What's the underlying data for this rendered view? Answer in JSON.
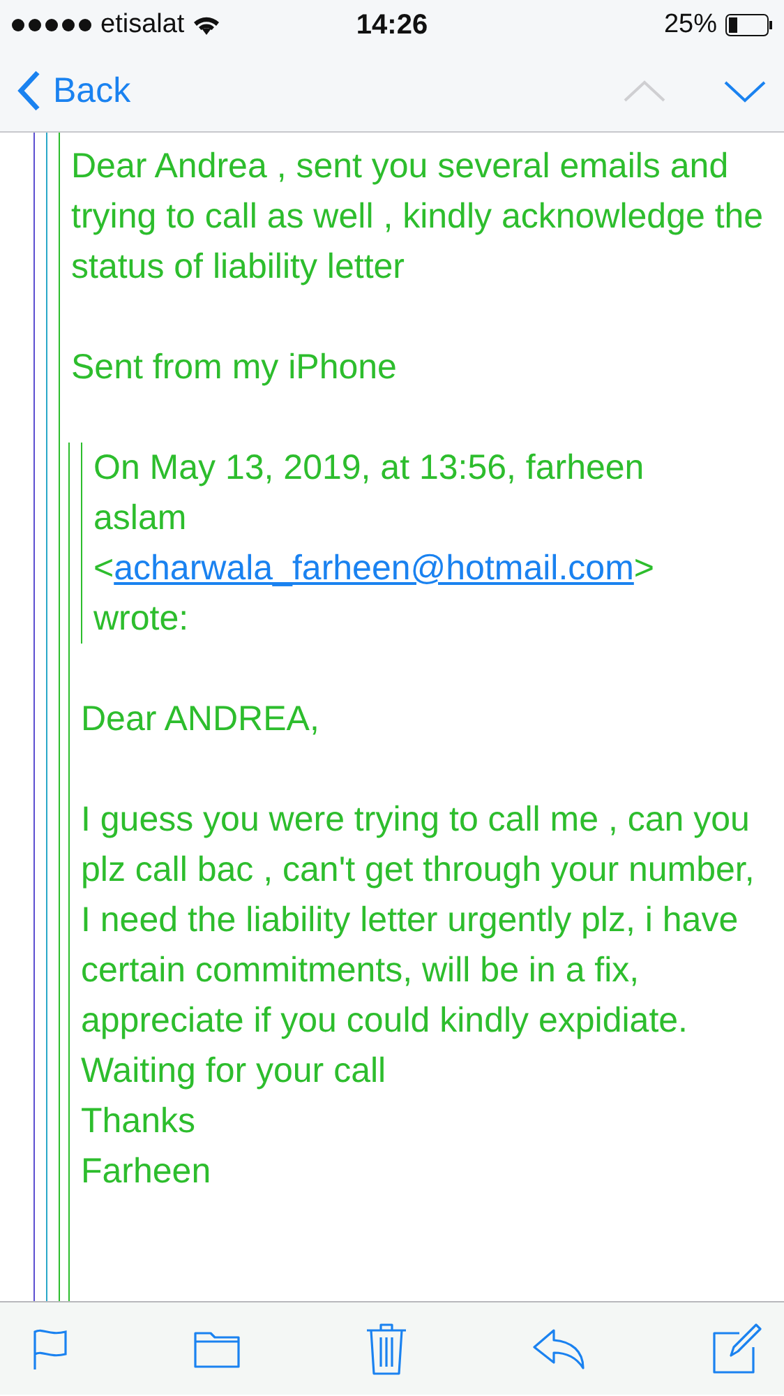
{
  "status_bar": {
    "carrier": "etisalat",
    "time": "14:26",
    "battery": "25%"
  },
  "nav_bar": {
    "back": "Back",
    "arrows": [
      {
        "kind": "up",
        "disabled": true
      },
      {
        "kind": "down",
        "disabled": false
      }
    ]
  },
  "message": {
    "paragraphs": [
      "Dear Andrea , sent you several emails and trying to call as well , kindly acknowledge the status of liability letter",
      "Sent from my iPhone"
    ],
    "quote": {
      "header_before": "On May 13, 2019, at 13:56, farheen aslam <",
      "header_link": "acharwala_farheen@hotmail.com",
      "header_after": "> wrote:",
      "greeting": "Dear ANDREA,",
      "body": [
        "I guess you were trying to call me , can you plz call bac , can't get through your number,",
        "I need the liability letter urgently plz, i have certain commitments, will be in a fix, appreciate if you could kindly expidiate.",
        "Waiting for your call",
        "Thanks",
        "Farheen"
      ]
    }
  },
  "toolbar": [
    {
      "kind": "flag"
    },
    {
      "kind": "folder"
    },
    {
      "kind": "trash"
    },
    {
      "kind": "reply"
    },
    {
      "kind": "compose"
    }
  ]
}
